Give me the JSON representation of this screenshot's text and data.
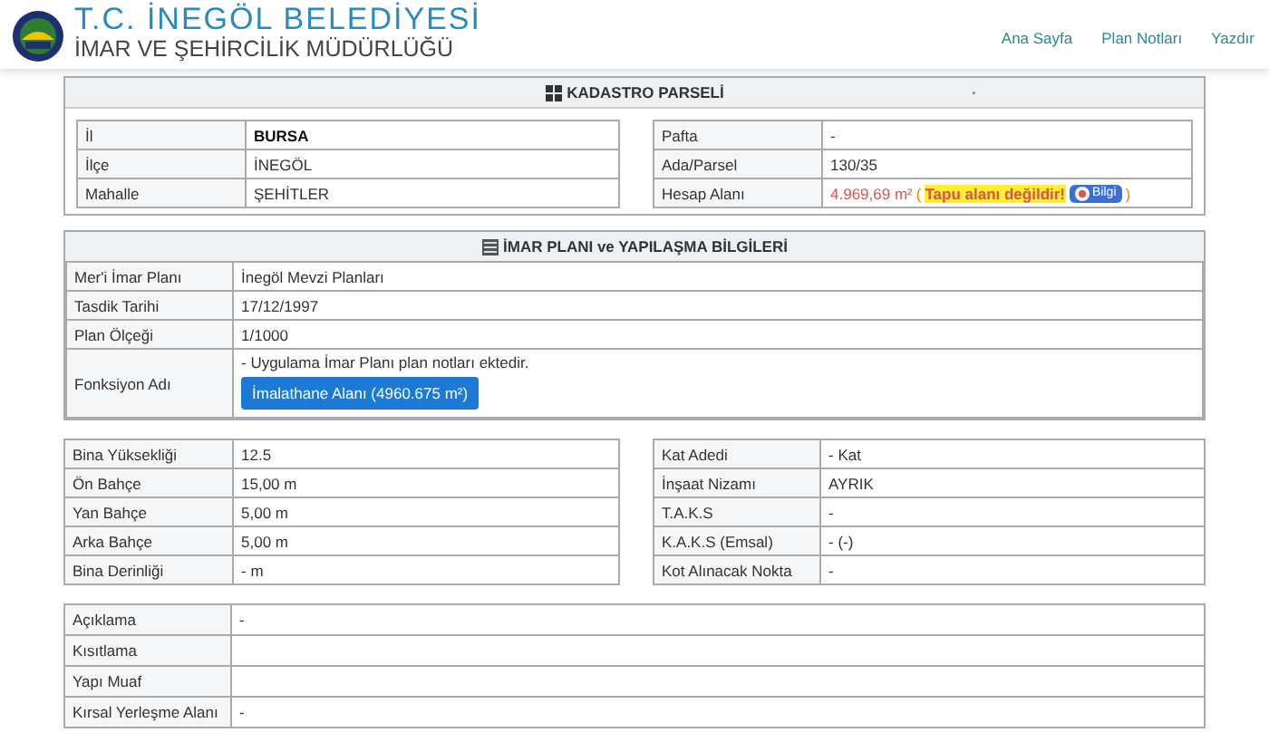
{
  "header": {
    "title": "T.C. İNEGÖL BELEDİYESİ",
    "subtitle": "İMAR VE ŞEHİRCİLİK MÜDÜRLÜĞÜ",
    "nav": [
      "Ana Sayfa",
      "Plan Notları",
      "Yazdır"
    ]
  },
  "kadastro": {
    "title": "KADASTRO PARSELİ",
    "marker": ".",
    "left": [
      {
        "label": "İl",
        "value": "BURSA",
        "bold": true
      },
      {
        "label": "İlçe",
        "value": "İNEGÖL",
        "bold": false
      },
      {
        "label": "Mahalle",
        "value": "ŞEHİTLER",
        "bold": false
      }
    ],
    "right": [
      {
        "label": "Pafta",
        "value": "-"
      },
      {
        "label": "Ada/Parsel",
        "value": "130/35"
      },
      {
        "label": "Hesap Alanı",
        "value": "4.969,69 m²",
        "note_open": "(",
        "note": "Tapu alanı değildir!",
        "info_button": "Bilgi",
        "note_close": ")"
      }
    ]
  },
  "imar": {
    "title": "İMAR PLANI ve YAPILAŞMA BİLGİLERİ",
    "rows": [
      {
        "label": "Mer'i İmar Planı",
        "value": "İnegöl Mevzi Planları"
      },
      {
        "label": "Tasdik Tarihi",
        "value": "17/12/1997"
      },
      {
        "label": "Plan Ölçeği",
        "value": "1/1000"
      },
      {
        "label": "Fonksiyon Adı",
        "value": "- Uygulama İmar Planı plan notları ektedir.",
        "button": "İmalathane Alanı (4960.675 m²)"
      }
    ]
  },
  "yapilasma": {
    "left": [
      {
        "label": "Bina Yüksekliği",
        "value": "12.5"
      },
      {
        "label": "Ön Bahçe",
        "value": "15,00 m"
      },
      {
        "label": "Yan Bahçe",
        "value": "5,00 m"
      },
      {
        "label": "Arka Bahçe",
        "value": "5,00 m"
      },
      {
        "label": "Bina Derinliği",
        "value": "- m"
      }
    ],
    "right": [
      {
        "label": "Kat Adedi",
        "value": "- Kat"
      },
      {
        "label": "İnşaat Nizamı",
        "value": "AYRIK"
      },
      {
        "label": "T.A.K.S",
        "value": "-"
      },
      {
        "label": "K.A.K.S (Emsal)",
        "value": "- (-)"
      },
      {
        "label": "Kot Alınacak Nokta",
        "value": "-"
      }
    ]
  },
  "diger": [
    {
      "label": "Açıklama",
      "value": "-"
    },
    {
      "label": "Kısıtlama"
    },
    {
      "label": "Yapı Muaf"
    },
    {
      "label": "Kırsal Yerleşme Alanı",
      "value": "-"
    }
  ]
}
